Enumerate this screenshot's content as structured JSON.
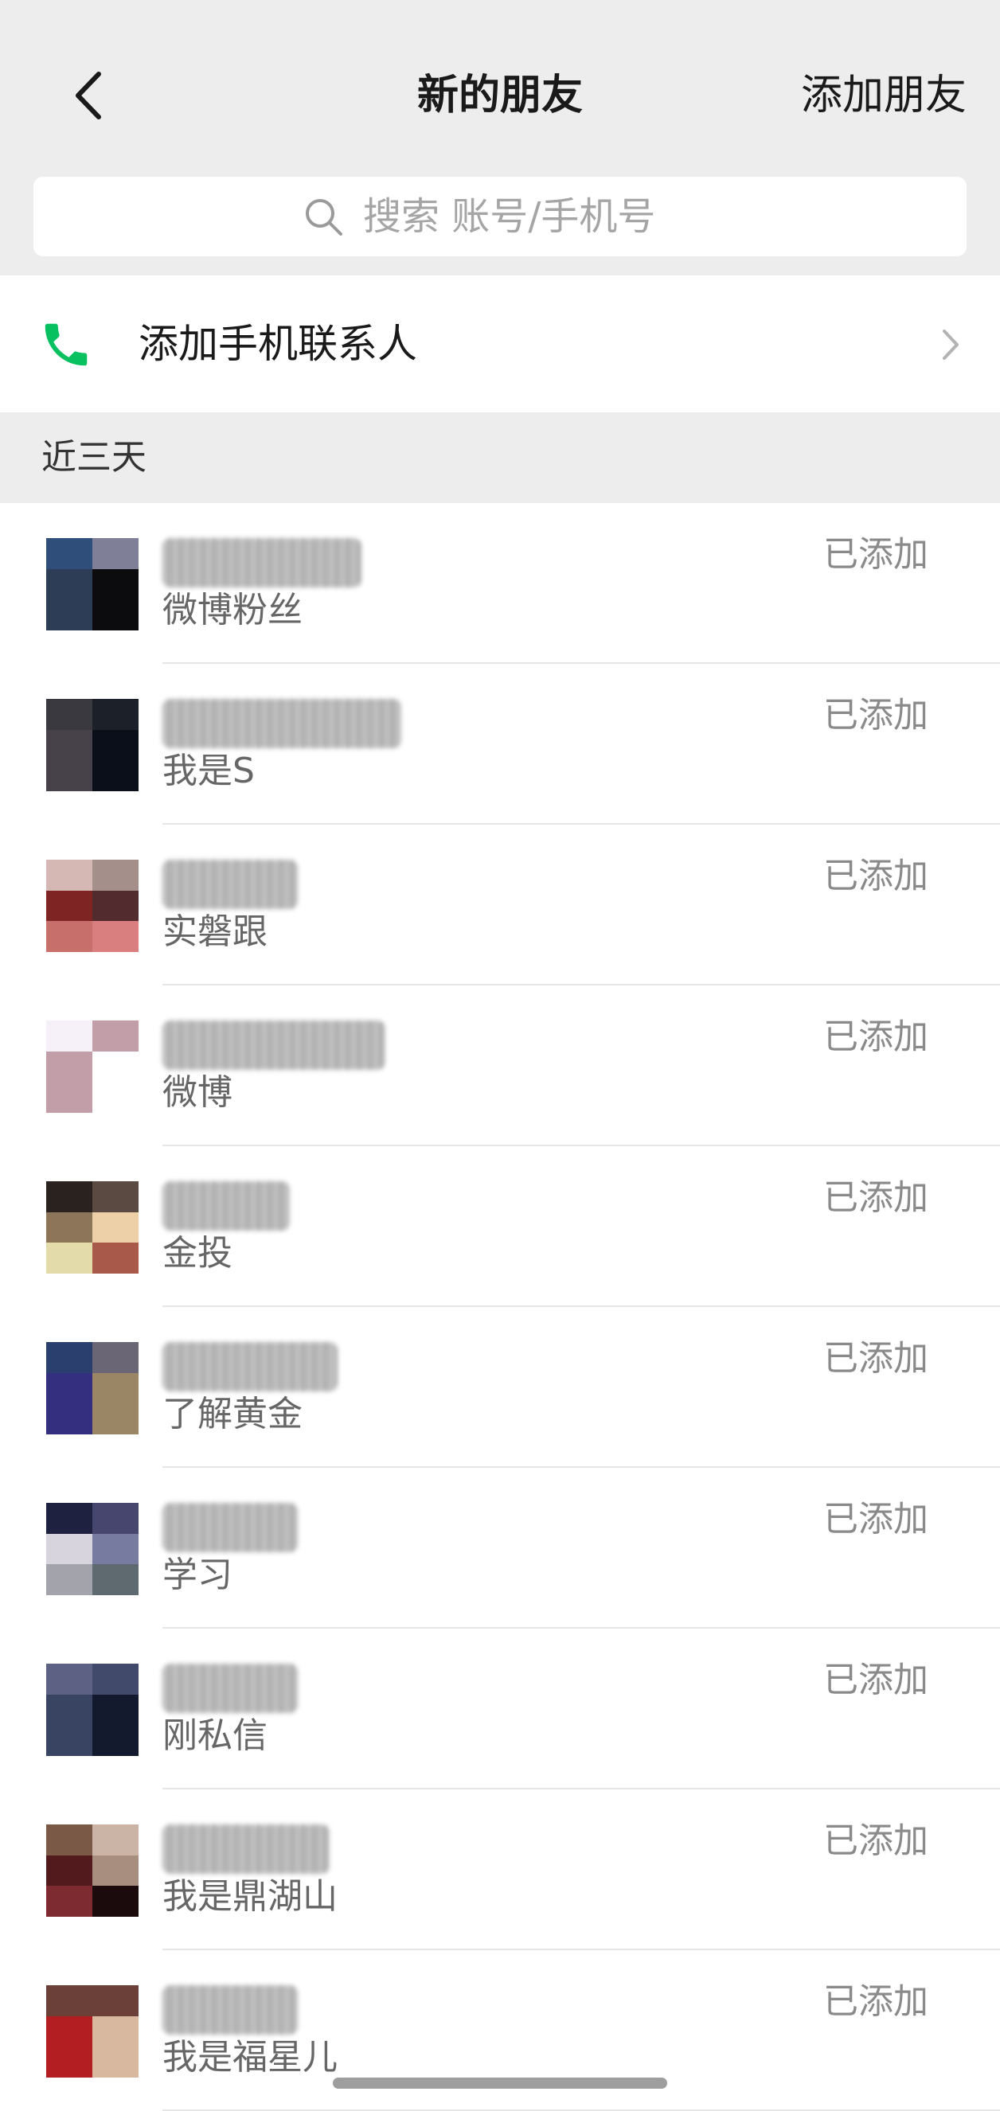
{
  "nav": {
    "title": "新的朋友",
    "action": "添加朋友"
  },
  "search": {
    "placeholder": "搜索 账号/手机号"
  },
  "add_contacts": {
    "label": "添加手机联系人",
    "icon": "phone-icon",
    "icon_color": "#07c160"
  },
  "section": {
    "title": "近三天"
  },
  "friends": [
    {
      "message": "微博粉丝",
      "status": "已添加",
      "avatar": [
        "#2f4f7a",
        "#7f7f98",
        "#2d3d55",
        "#0c0c0e",
        "#2d3d55",
        "#0c0c0e"
      ]
    },
    {
      "message": "我是S",
      "status": "已添加",
      "avatar": [
        "#3b3940",
        "#1b2029",
        "#474249",
        "#0b0f1a",
        "#474249",
        "#0b0f1a"
      ]
    },
    {
      "message": "实磐跟",
      "status": "已添加",
      "avatar": [
        "#d5b8b3",
        "#a58f8b",
        "#7e2523",
        "#522b2e",
        "#c66f6b",
        "#d97f7f"
      ]
    },
    {
      "message": "微博",
      "status": "已添加",
      "avatar": [
        "#f6f1f8",
        "#c29ea8",
        "#c29ea8",
        "#ffffff",
        "#c29ea8",
        "#ffffff"
      ]
    },
    {
      "message": "金投",
      "status": "已添加",
      "avatar": [
        "#2a221e",
        "#5a4a42",
        "#8c7558",
        "#eed0a8",
        "#e3dba9",
        "#a9594a"
      ]
    },
    {
      "message": "了解黄金",
      "status": "已添加",
      "avatar": [
        "#2a3f6d",
        "#6a6676",
        "#342f7e",
        "#9a8665",
        "#342f7e",
        "#9a8665"
      ]
    },
    {
      "message": "学习",
      "status": "已添加",
      "avatar": [
        "#1e2240",
        "#46466f",
        "#d8d4de",
        "#787ba0",
        "#a3a3ab",
        "#5f6a70"
      ]
    },
    {
      "message": "刚私信",
      "status": "已添加",
      "avatar": [
        "#5d6184",
        "#414a6a",
        "#384461",
        "#131a2d",
        "#384461",
        "#131a2d"
      ]
    },
    {
      "message": "我是鼎湖山",
      "status": "已添加",
      "avatar": [
        "#7a5a47",
        "#cbb3a6",
        "#521a1d",
        "#a88e7f",
        "#7e2a31",
        "#1b0b0c"
      ]
    },
    {
      "message": "我是福星儿",
      "status": "已添加",
      "avatar": [
        "#6b4038",
        "#6b4038",
        "#b21e22",
        "#d8b89e",
        "#b21e22",
        "#d8b89e"
      ]
    }
  ]
}
